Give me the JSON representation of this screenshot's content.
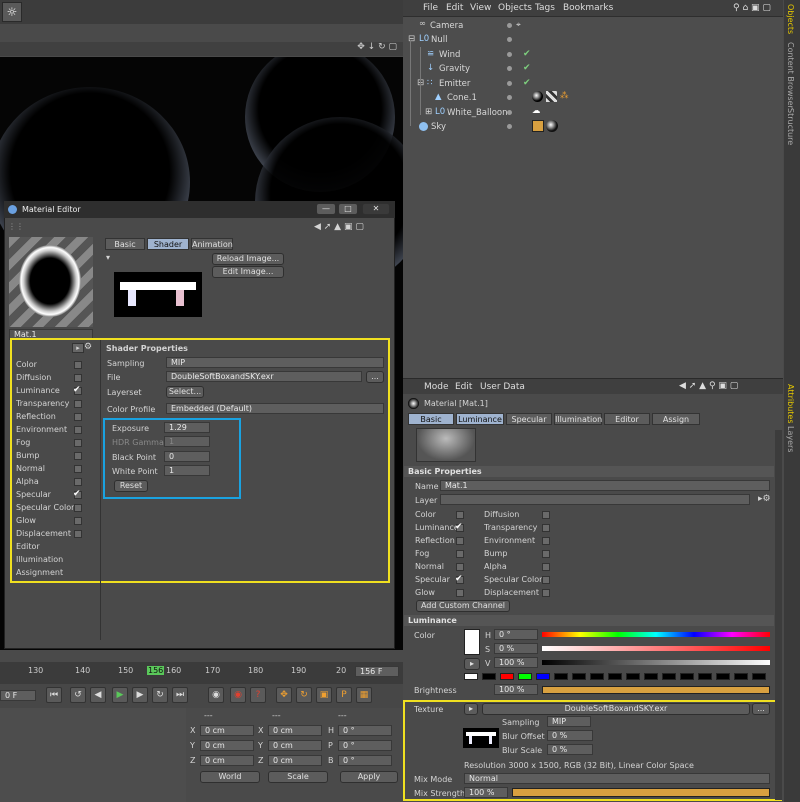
{
  "objects_menu": {
    "items": [
      "File",
      "Edit",
      "View",
      "Objects",
      "Tags",
      "Bookmarks"
    ]
  },
  "side_tabs_top": [
    "Objects",
    "Content Browser",
    "Structure"
  ],
  "side_tabs_attr": [
    "Attributes",
    "Layers"
  ],
  "tree": [
    {
      "name": "Camera",
      "icon": "camera-icon"
    },
    {
      "name": "Null",
      "icon": "null-icon"
    },
    {
      "name": "Wind",
      "icon": "wind-icon"
    },
    {
      "name": "Gravity",
      "icon": "gravity-icon"
    },
    {
      "name": "Emitter",
      "icon": "emitter-icon"
    },
    {
      "name": "Cone.1",
      "icon": "cone-icon"
    },
    {
      "name": "White_Balloon",
      "icon": "null-icon"
    },
    {
      "name": "Sky",
      "icon": "sky-icon"
    }
  ],
  "material_editor": {
    "title": "Material Editor",
    "tabs": [
      "Basic",
      "Shader",
      "Animation"
    ],
    "material_name": "Mat.1",
    "reload_label": "Reload Image...",
    "edit_label": "Edit Image...",
    "shader_properties_label": "Shader Properties",
    "sampling_label": "Sampling",
    "sampling_value": "MIP",
    "file_label": "File",
    "file_value": "DoubleSoftBoxandSKY.exr",
    "file_btn": "...",
    "layerset_label": "Layerset",
    "layerset_btn": "Select...",
    "color_profile_label": "Color Profile",
    "color_profile_value": "Embedded (Default)",
    "exposure_label": "Exposure",
    "exposure_value": "1.29",
    "hdr_gamma_label": "HDR Gamma",
    "hdr_gamma_value": "1",
    "black_point_label": "Black Point",
    "black_point_value": "0",
    "white_point_label": "White Point",
    "white_point_value": "1",
    "reset_label": "Reset",
    "channels": [
      {
        "name": "Color",
        "checked": false
      },
      {
        "name": "Diffusion",
        "checked": false
      },
      {
        "name": "Luminance",
        "checked": true
      },
      {
        "name": "Transparency",
        "checked": false
      },
      {
        "name": "Reflection",
        "checked": false
      },
      {
        "name": "Environment",
        "checked": false
      },
      {
        "name": "Fog",
        "checked": false
      },
      {
        "name": "Bump",
        "checked": false
      },
      {
        "name": "Normal",
        "checked": false
      },
      {
        "name": "Alpha",
        "checked": false
      },
      {
        "name": "Specular",
        "checked": true
      },
      {
        "name": "Specular Color",
        "checked": false
      },
      {
        "name": "Glow",
        "checked": false
      },
      {
        "name": "Displacement",
        "checked": false
      },
      {
        "name": "Editor",
        "checked": null
      },
      {
        "name": "Illumination",
        "checked": null
      },
      {
        "name": "Assignment",
        "checked": null
      }
    ]
  },
  "timeline": {
    "ticks": [
      "130",
      "140",
      "150",
      "156",
      "160",
      "170",
      "180",
      "190",
      "20"
    ],
    "frame_display": "156 F",
    "left_frame": "0 F"
  },
  "coords": {
    "rows": [
      [
        "X",
        "0 cm",
        "X",
        "0 cm",
        "H",
        "0 °"
      ],
      [
        "Y",
        "0 cm",
        "Y",
        "0 cm",
        "P",
        "0 °"
      ],
      [
        "Z",
        "0 cm",
        "Z",
        "0 cm",
        "B",
        "0 °"
      ]
    ],
    "world_label": "World",
    "scale_label": "Scale",
    "apply_label": "Apply",
    "dashes": "---"
  },
  "attributes": {
    "menu": [
      "Mode",
      "Edit",
      "User Data"
    ],
    "material_title": "Material [Mat.1]",
    "tabs": [
      "Basic",
      "Luminance",
      "Specular",
      "Illumination",
      "Editor",
      "Assign"
    ],
    "basic_properties_label": "Basic Properties",
    "name_label": "Name",
    "name_value": "Mat.1",
    "layer_label": "Layer",
    "left_channels": [
      {
        "name": "Color",
        "checked": false
      },
      {
        "name": "Luminance",
        "checked": true
      },
      {
        "name": "Reflection",
        "checked": false
      },
      {
        "name": "Fog",
        "checked": false
      },
      {
        "name": "Normal",
        "checked": false
      },
      {
        "name": "Specular",
        "checked": true
      },
      {
        "name": "Glow",
        "checked": false
      }
    ],
    "right_channels": [
      {
        "name": "Diffusion",
        "checked": false
      },
      {
        "name": "Transparency",
        "checked": false
      },
      {
        "name": "Environment",
        "checked": false
      },
      {
        "name": "Bump",
        "checked": false
      },
      {
        "name": "Alpha",
        "checked": false
      },
      {
        "name": "Specular Color",
        "checked": false
      },
      {
        "name": "Displacement",
        "checked": false
      }
    ],
    "add_channel_label": "Add Custom Channel",
    "luminance_label": "Luminance",
    "color_label": "Color",
    "h_label": "H",
    "h_value": "0 °",
    "s_label": "S",
    "s_value": "0 %",
    "v_label": "V",
    "v_value": "100 %",
    "brightness_label": "Brightness",
    "brightness_value": "100 %",
    "brightness_level": 1.0,
    "texture_label": "Texture",
    "texture_value": "DoubleSoftBoxandSKY.exr",
    "texture_btn": "...",
    "sampling_label": "Sampling",
    "sampling_value": "MIP",
    "blur_offset_label": "Blur Offset",
    "blur_offset_value": "0 %",
    "blur_scale_label": "Blur Scale",
    "blur_scale_value": "0 %",
    "resolution_text": "Resolution 3000 x 1500, RGB (32 Bit), Linear Color Space",
    "mix_mode_label": "Mix Mode",
    "mix_mode_value": "Normal",
    "mix_strength_label": "Mix Strength",
    "mix_strength_value": "100 %",
    "mix_strength_level": 1.0,
    "swatches": [
      "#ffffff",
      "#000000",
      "#ff0000",
      "#00ff00",
      "#0000ff",
      "#000000",
      "#000000",
      "#000000",
      "#000000",
      "#000000",
      "#000000",
      "#000000",
      "#000000",
      "#000000",
      "#000000",
      "#000000",
      "#000000"
    ]
  },
  "colors": {
    "highlight_yellow": "#f0e020",
    "highlight_blue": "#1aa2e0",
    "active_tab": "#9fb3cf"
  }
}
